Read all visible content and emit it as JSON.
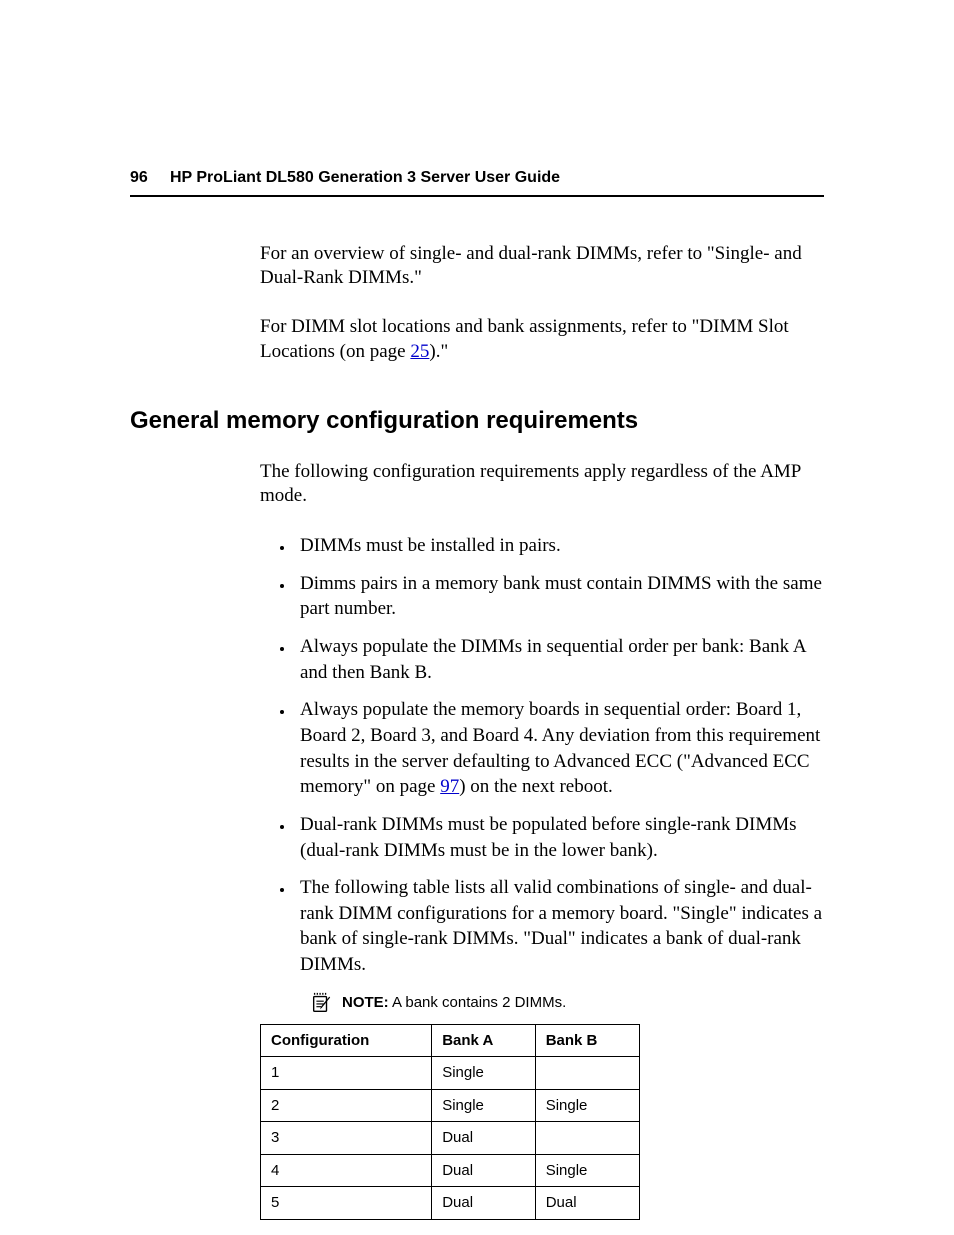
{
  "header": {
    "page_num": "96",
    "title": "HP ProLiant DL580 Generation 3 Server User Guide"
  },
  "intro": {
    "p1a": "For an overview of single- and dual-rank DIMMs, refer to \"Single- and Dual-Rank DIMMs.\"",
    "p2a": "For DIMM slot locations and bank assignments, refer to \"DIMM Slot Locations (on page ",
    "p2link": "25",
    "p2b": ").\""
  },
  "section": {
    "heading": "General memory configuration requirements",
    "lead": "The following configuration requirements apply regardless of the AMP mode.",
    "bullets": {
      "b1": "DIMMs must be installed in pairs.",
      "b2": "Dimms pairs in a memory bank must contain DIMMS with the same part number.",
      "b3": "Always populate the DIMMs in sequential order per bank: Bank A and then Bank B.",
      "b4a": "Always populate the memory boards in sequential order: Board 1, Board 2, Board 3, and Board 4. Any deviation from this requirement results in the server defaulting to Advanced ECC (\"Advanced ECC memory\" on page ",
      "b4link": "97",
      "b4b": ") on the next reboot.",
      "b5": "Dual-rank DIMMs must be populated before single-rank DIMMs (dual-rank DIMMs must be in the lower bank).",
      "b6": "The following table lists all valid combinations of single- and dual-rank DIMM configurations for a memory board. \"Single\" indicates a bank of single-rank DIMMs. \"Dual\" indicates a bank of dual-rank DIMMs."
    }
  },
  "note": {
    "label": "NOTE:",
    "text": " A bank contains 2 DIMMs."
  },
  "table": {
    "headers": {
      "c0": "Configuration",
      "c1": "Bank A",
      "c2": "Bank B"
    },
    "rows": [
      {
        "c0": "1",
        "c1": "Single",
        "c2": ""
      },
      {
        "c0": "2",
        "c1": "Single",
        "c2": "Single"
      },
      {
        "c0": "3",
        "c1": "Dual",
        "c2": ""
      },
      {
        "c0": "4",
        "c1": "Dual",
        "c2": "Single"
      },
      {
        "c0": "5",
        "c1": "Dual",
        "c2": "Dual"
      }
    ]
  }
}
